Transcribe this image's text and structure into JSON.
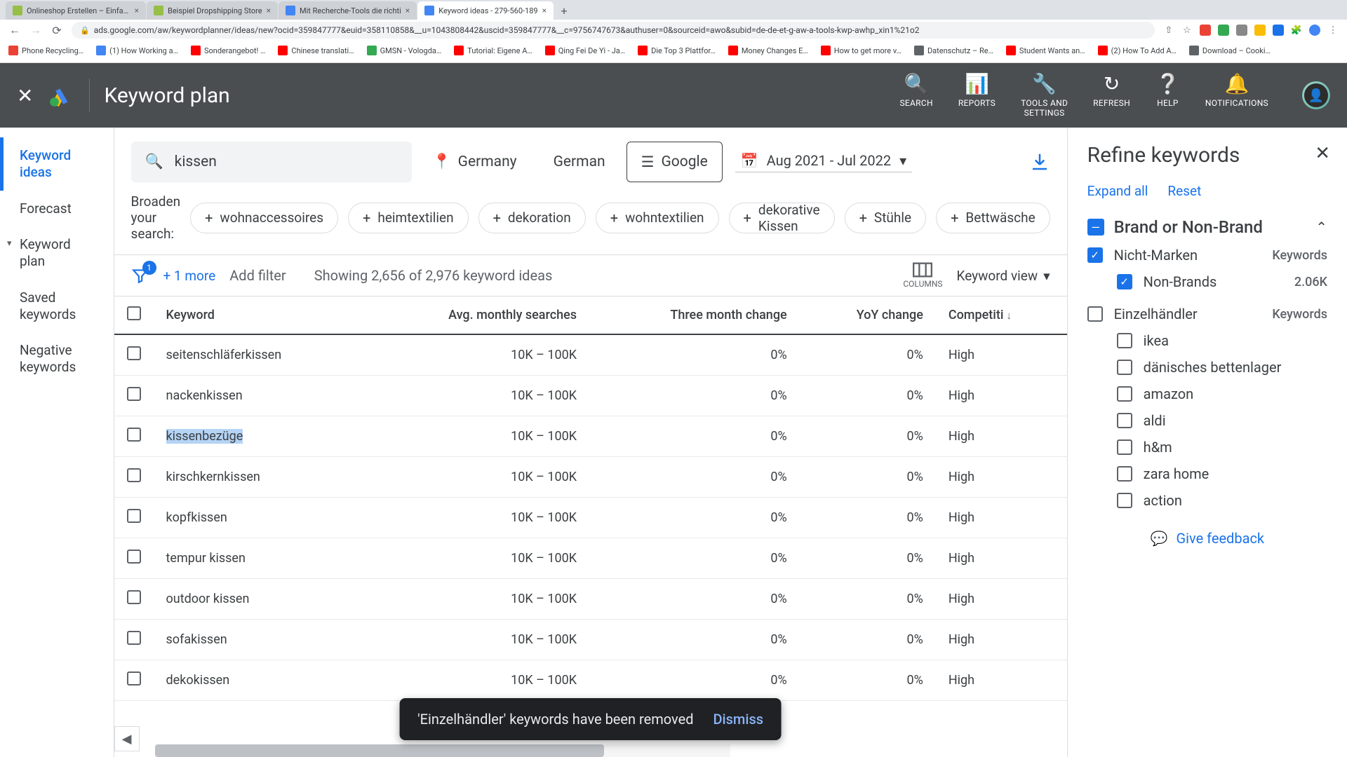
{
  "browser": {
    "tabs": [
      {
        "title": "Onlineshop Erstellen – Einfach",
        "active": false
      },
      {
        "title": "Beispiel Dropshipping Store",
        "active": false
      },
      {
        "title": "Mit Recherche-Tools die richti",
        "active": false
      },
      {
        "title": "Keyword ideas - 279-560-189",
        "active": true
      }
    ],
    "url": "ads.google.com/aw/keywordplanner/ideas/new?ocid=359847777&euid=358110858&__u=1043808442&uscid=359847777&__c=9756747673&authuser=0&sourceid=awo&subid=de-de-et-g-aw-a-tools-kwp-awhp_xin1%21o2",
    "bookmarks": [
      "Phone Recycling…",
      "(1) How Working a…",
      "Sonderangebot! …",
      "Chinese translati…",
      "GMSN - Vologda…",
      "Tutorial: Eigene A…",
      "Qing Fei De Yi - Ja…",
      "Die Top 3 Plattfor…",
      "Money Changes E…",
      "How to get more v…",
      "Datenschutz – Re…",
      "Student Wants an…",
      "(2) How To Add A…",
      "Download – Cooki…"
    ]
  },
  "header": {
    "title": "Keyword plan",
    "actions": {
      "search": "SEARCH",
      "reports": "REPORTS",
      "tools": "TOOLS AND\nSETTINGS",
      "refresh": "REFRESH",
      "help": "HELP",
      "notifications": "NOTIFICATIONS"
    }
  },
  "left_nav": {
    "items": [
      "Keyword ideas",
      "Forecast",
      "Keyword plan",
      "Saved keywords",
      "Negative keywords"
    ],
    "active_index": 0,
    "expandable_index": 2
  },
  "filters": {
    "search_term": "kissen",
    "location": "Germany",
    "language": "German",
    "network": "Google",
    "date_range": "Aug 2021 - Jul 2022"
  },
  "broaden": {
    "label": "Broaden your search:",
    "suggestions": [
      "wohnaccessoires",
      "heimtextilien",
      "dekoration",
      "wohntextilien",
      "dekorative Kissen",
      "Stühle",
      "Bettwäsche"
    ]
  },
  "toolbar": {
    "filter_count": "1",
    "more_filters": "+ 1 more",
    "add_filter": "Add filter",
    "showing": "Showing 2,656 of 2,976 keyword ideas",
    "columns_label": "COLUMNS",
    "view": "Keyword view"
  },
  "table": {
    "columns": [
      "Keyword",
      "Avg. monthly searches",
      "Three month change",
      "YoY change",
      "Competiti"
    ],
    "rows": [
      {
        "kw": "seitenschläferkissen",
        "searches": "10K – 100K",
        "tm": "0%",
        "yoy": "0%",
        "comp": "High"
      },
      {
        "kw": "nackenkissen",
        "searches": "10K – 100K",
        "tm": "0%",
        "yoy": "0%",
        "comp": "High"
      },
      {
        "kw": "kissenbezüge",
        "searches": "10K – 100K",
        "tm": "0%",
        "yoy": "0%",
        "comp": "High",
        "selected": true
      },
      {
        "kw": "kirschkernkissen",
        "searches": "10K – 100K",
        "tm": "0%",
        "yoy": "0%",
        "comp": "High"
      },
      {
        "kw": "kopfkissen",
        "searches": "10K – 100K",
        "tm": "0%",
        "yoy": "0%",
        "comp": "High"
      },
      {
        "kw": "tempur kissen",
        "searches": "10K – 100K",
        "tm": "0%",
        "yoy": "0%",
        "comp": "High"
      },
      {
        "kw": "outdoor kissen",
        "searches": "10K – 100K",
        "tm": "0%",
        "yoy": "0%",
        "comp": "High"
      },
      {
        "kw": "sofakissen",
        "searches": "10K – 100K",
        "tm": "0%",
        "yoy": "0%",
        "comp": "High"
      },
      {
        "kw": "dekokissen",
        "searches": "10K – 100K",
        "tm": "0%",
        "yoy": "0%",
        "comp": "High"
      }
    ]
  },
  "panel": {
    "title": "Refine keywords",
    "expand_all": "Expand all",
    "reset": "Reset",
    "facet": {
      "title": "Brand or Non-Brand",
      "group1": {
        "label": "Nicht-Marken",
        "right": "Keywords",
        "checked": true
      },
      "sub1": {
        "label": "Non-Brands",
        "right": "2.06K",
        "checked": true
      },
      "group2": {
        "label": "Einzelhändler",
        "right": "Keywords",
        "checked": false
      },
      "retailers": [
        "ikea",
        "dänisches bettenlager",
        "amazon",
        "aldi",
        "h&m",
        "zara home",
        "action"
      ]
    },
    "feedback": "Give feedback"
  },
  "toast": {
    "message": "'Einzelhändler' keywords have been removed",
    "dismiss": "Dismiss"
  }
}
